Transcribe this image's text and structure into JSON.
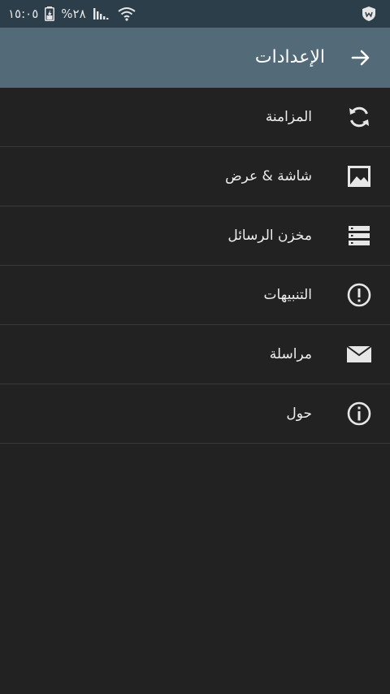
{
  "status_bar": {
    "time": "١٥:٠٥",
    "battery": "%٢٨"
  },
  "header": {
    "title": "الإعدادات"
  },
  "menu": {
    "items": [
      {
        "label": "المزامنة",
        "icon": "sync-icon"
      },
      {
        "label": "شاشة & عرض",
        "icon": "image-icon"
      },
      {
        "label": "مخزن الرسائل",
        "icon": "storage-icon"
      },
      {
        "label": "التنبيهات",
        "icon": "alert-icon"
      },
      {
        "label": "مراسلة",
        "icon": "mail-icon"
      },
      {
        "label": "حول",
        "icon": "info-icon"
      }
    ]
  },
  "colors": {
    "status_bar": "#2c3e4a",
    "app_bar": "#536a79",
    "background": "#222222",
    "divider": "#3a3a3a",
    "text": "#eeeeee"
  }
}
